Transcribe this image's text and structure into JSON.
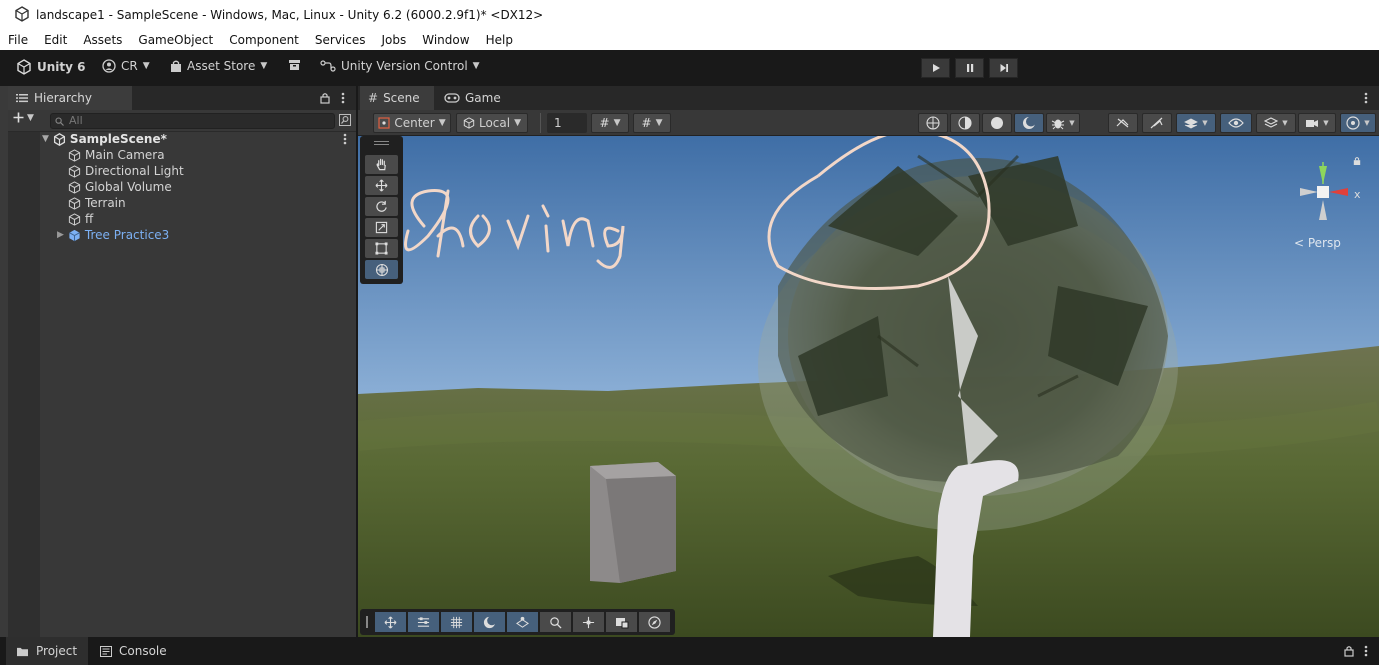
{
  "window": {
    "title": "landscape1 - SampleScene - Windows, Mac, Linux - Unity 6.2 (6000.2.9f1)* <DX12>",
    "icon": "unity-logo-icon"
  },
  "menu": [
    "File",
    "Edit",
    "Assets",
    "GameObject",
    "Component",
    "Services",
    "Jobs",
    "Window",
    "Help"
  ],
  "toolbar": {
    "unity_label": "Unity 6",
    "account_label": "CR",
    "asset_store_label": "Asset Store",
    "version_control_label": "Unity Version Control"
  },
  "hierarchy": {
    "tab_label": "Hierarchy",
    "search_placeholder": "All",
    "scene_name": "SampleScene*",
    "items": [
      {
        "label": "Main Camera",
        "icon": "cube-outline-icon"
      },
      {
        "label": "Directional Light",
        "icon": "cube-outline-icon"
      },
      {
        "label": "Global Volume",
        "icon": "cube-outline-icon"
      },
      {
        "label": "Terrain",
        "icon": "cube-outline-icon"
      },
      {
        "label": "ff",
        "icon": "cube-outline-icon"
      },
      {
        "label": "Tree Practice3",
        "icon": "prefab-icon",
        "color": "#7cb0f3"
      }
    ]
  },
  "scene_view": {
    "tabs": [
      {
        "label": "Scene",
        "icon": "grid-icon"
      },
      {
        "label": "Game",
        "icon": "gamepad-icon"
      }
    ],
    "pivot_mode": "Center",
    "pivot_rotation": "Local",
    "grid_snap_value": "1",
    "perspective_label": "< Persp",
    "gizmo_axis_label": "x",
    "annotation_text": "Showing"
  },
  "bottom": {
    "tabs": [
      {
        "label": "Project",
        "icon": "folder-icon"
      },
      {
        "label": "Console",
        "icon": "console-icon"
      }
    ]
  },
  "colors": {
    "accent_blue": "#46607c",
    "prefab_blue": "#7cb0f3",
    "annotation": "#f2d7c8"
  }
}
